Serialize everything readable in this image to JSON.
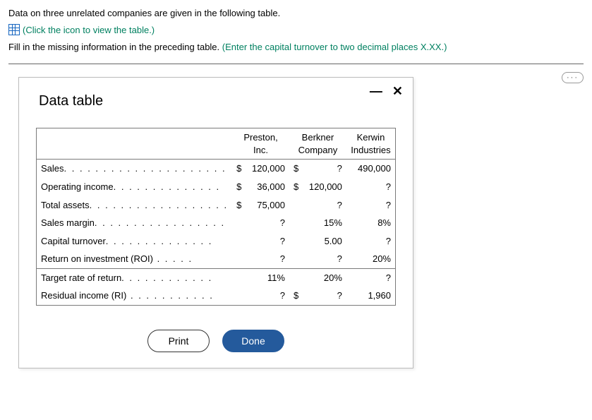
{
  "instructions": {
    "line1": "Data on three unrelated companies are given in the following table.",
    "link_text": "(Click the icon to view the table.)",
    "line2_a": "Fill in the missing information in the preceding table. ",
    "line2_b": "(Enter the capital turnover to two decimal places X.XX.)"
  },
  "dialog": {
    "title": "Data table",
    "min_label": "—",
    "close_label": "✕",
    "print_label": "Print",
    "done_label": "Done"
  },
  "table": {
    "headers": {
      "blank": "",
      "c1": "Preston, Inc.",
      "c2": "Berkner Company",
      "c3": "Kerwin Industries"
    },
    "rows": [
      {
        "label": "Sales",
        "dots": ". . . . . . . . . . . . . . . . . . . . .",
        "cur": "$",
        "c1": "120,000",
        "c2_cur": "$",
        "c2": "?",
        "c3": "490,000"
      },
      {
        "label": "Operating income",
        "dots": ". . . . . . . . . . . . . .",
        "cur": "$",
        "c1": "36,000",
        "c2_cur": "$",
        "c2": "120,000",
        "c3": "?"
      },
      {
        "label": "Total assets",
        "dots": ". . . . . . . . . . . . . . . . . .",
        "cur": "$",
        "c1": "75,000",
        "c2_cur": "",
        "c2": "?",
        "c3": "?"
      },
      {
        "label": "Sales margin",
        "dots": ". . . . . . . . . . . . . . . . .",
        "cur": "",
        "c1": "?",
        "c2_cur": "",
        "c2": "15%",
        "c3": "8%"
      },
      {
        "label": "Capital turnover",
        "dots": ". . . . . . . . . . . . . .",
        "cur": "",
        "c1": "?",
        "c2_cur": "",
        "c2": "5.00",
        "c3": "?"
      },
      {
        "label": "Return on investment (ROI)",
        "dots": " . . . . .",
        "cur": "",
        "c1": "?",
        "c2_cur": "",
        "c2": "?",
        "c3": "20%"
      },
      {
        "label": "Target rate of return",
        "dots": ". . . . . . . . . . . .",
        "cur": "",
        "c1": "11%",
        "c2_cur": "",
        "c2": "20%",
        "c3": "?",
        "section": true
      },
      {
        "label": "Residual income (RI)",
        "dots": " . . . . . . . . . . .",
        "cur": "",
        "c1": "?",
        "c2_cur": "$",
        "c2": "?",
        "c3": "1,960"
      }
    ]
  },
  "ellipsis": "···"
}
